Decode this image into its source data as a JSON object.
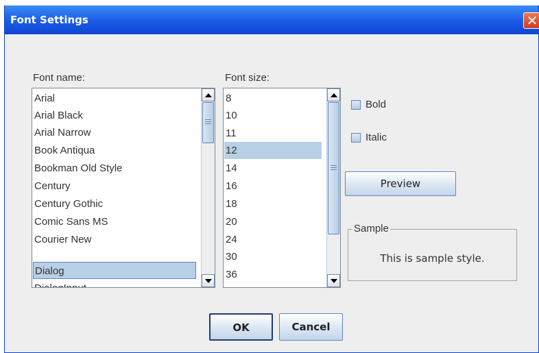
{
  "window": {
    "title": "Font Settings",
    "close_glyph": "✕"
  },
  "font_name": {
    "label": "Font name:",
    "items": [
      "Arial",
      "Arial Black",
      "Arial Narrow",
      "Book Antiqua",
      "Bookman Old Style",
      "Century",
      "Century Gothic",
      "Comic Sans MS",
      "Courier New",
      "Dialog",
      "DialogInput"
    ],
    "selected": "Dialog"
  },
  "font_size": {
    "label": "Font size:",
    "items": [
      "8",
      "10",
      "11",
      "12",
      "14",
      "16",
      "18",
      "20",
      "24",
      "30",
      "36"
    ],
    "selected": "12"
  },
  "options": {
    "bold_label": "Bold",
    "italic_label": "Italic",
    "bold_checked": false,
    "italic_checked": false
  },
  "preview_button": "Preview",
  "sample": {
    "legend": "Sample",
    "text": "This is sample style."
  },
  "buttons": {
    "ok": "OK",
    "cancel": "Cancel"
  },
  "colors": {
    "title_bar": "#1a5be6",
    "selection": "#b8cfe5",
    "dialog_bg": "#eeeeee",
    "close_button": "#e35a3c"
  },
  "icons": [
    "close-icon",
    "scroll-up-arrow-icon",
    "scroll-down-arrow-icon",
    "checkbox-icon"
  ]
}
